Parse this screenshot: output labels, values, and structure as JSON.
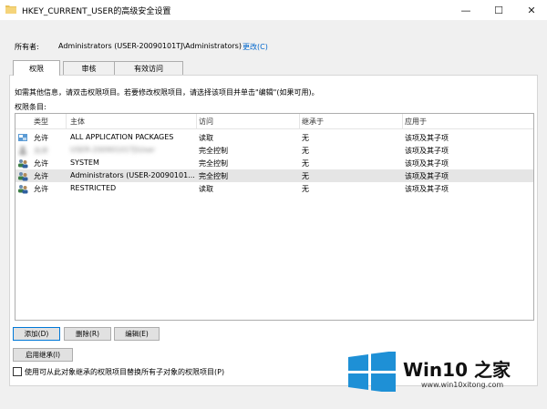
{
  "window": {
    "title": "HKEY_CURRENT_USER的高级安全设置",
    "minimize_icon": "—",
    "maximize_icon": "☐",
    "close_icon": "✕"
  },
  "owner": {
    "label": "所有者:",
    "value": "Administrators (USER-20090101TJ\\Administrators)",
    "change_link": "更改(C)"
  },
  "tabs": [
    {
      "label": "权限",
      "active": true
    },
    {
      "label": "审核",
      "active": false
    },
    {
      "label": "有效访问",
      "active": false
    }
  ],
  "hint": "如需其他信息，请双击权限项目。若要修改权限项目，请选择该项目并单击\"编辑\"(如果可用)。",
  "entries_label": "权限条目:",
  "table": {
    "columns": [
      "类型",
      "主体",
      "访问",
      "继承于",
      "应用于"
    ],
    "rows": [
      {
        "type": "允许",
        "principal": "ALL APPLICATION PACKAGES",
        "access": "读取",
        "inherited": "无",
        "applies": "该项及其子项",
        "icon": "package-icon",
        "blurred": false,
        "selected": false
      },
      {
        "type": "允许",
        "principal": "USER-20090101TJ\\User",
        "access": "完全控制",
        "inherited": "无",
        "applies": "该项及其子项",
        "icon": "user-icon",
        "blurred": true,
        "selected": false
      },
      {
        "type": "允许",
        "principal": "SYSTEM",
        "access": "完全控制",
        "inherited": "无",
        "applies": "该项及其子项",
        "icon": "users-icon",
        "blurred": false,
        "selected": false
      },
      {
        "type": "允许",
        "principal": "Administrators (USER-20090101...",
        "access": "完全控制",
        "inherited": "无",
        "applies": "该项及其子项",
        "icon": "users-icon",
        "blurred": false,
        "selected": true
      },
      {
        "type": "允许",
        "principal": "RESTRICTED",
        "access": "读取",
        "inherited": "无",
        "applies": "该项及其子项",
        "icon": "users-icon",
        "blurred": false,
        "selected": false
      }
    ]
  },
  "buttons": {
    "add": "添加(D)",
    "remove": "删除(R)",
    "edit": "编辑(E)",
    "enable_inheritance": "启用继承(I)"
  },
  "replace_checkbox": {
    "label": "使用可从此对象继承的权限项目替换所有子对象的权限项目(P)",
    "checked": false
  },
  "watermark": {
    "brand": "Win10 之家",
    "url": "www.win10xitong.com"
  },
  "colors": {
    "accent": "#0078d7",
    "link": "#0066cc",
    "selected_row": "#e5e5e5"
  }
}
